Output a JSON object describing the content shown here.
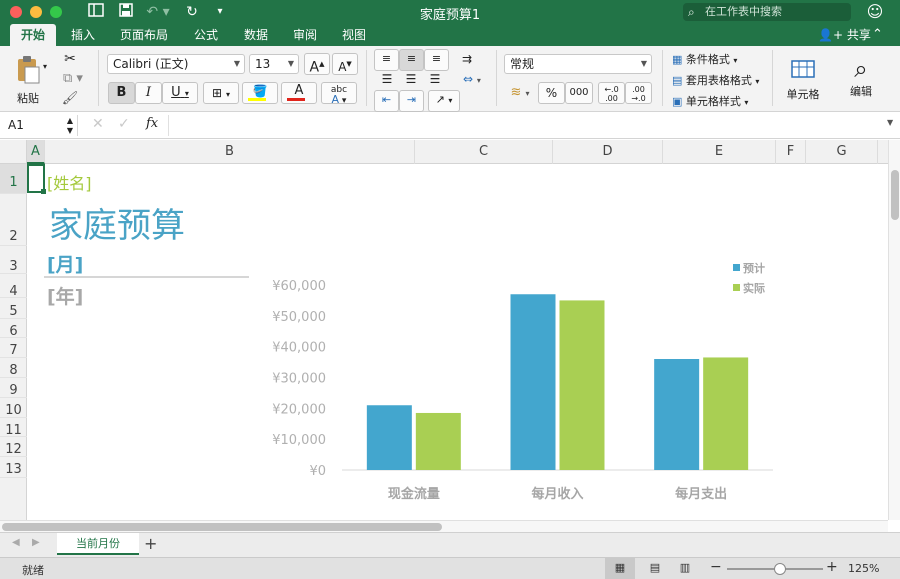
{
  "window": {
    "title": "家庭预算1",
    "search_placeholder": "在工作表中搜索",
    "traffic_colors": [
      "#fc605c",
      "#fdbc40",
      "#34c84a"
    ]
  },
  "tabs": [
    "开始",
    "插入",
    "页面布局",
    "公式",
    "数据",
    "审阅",
    "视图"
  ],
  "share_label": "共享",
  "ribbon": {
    "paste_label": "粘贴",
    "font_name": "Calibri (正文)",
    "font_size": "13",
    "grow_label": "A",
    "shrink_label": "A",
    "bold": "B",
    "italic": "I",
    "underline": "U",
    "font_color_label": "A",
    "highlight_color": "#ffff00",
    "font_color": "#e0241b",
    "number_format": "常规",
    "percent": "%",
    "comma": "000",
    "inc_decimal": "←.0 .00",
    "dec_decimal": ".00 →.0",
    "cond_format": "条件格式",
    "table_format": "套用表格格式",
    "cell_style": "单元格样式",
    "cells_label": "单元格",
    "edit_label": "编辑"
  },
  "formula_bar": {
    "name_box": "A1",
    "fx": "fx",
    "value": ""
  },
  "columns": [
    "A",
    "B",
    "C",
    "D",
    "E",
    "F",
    "G"
  ],
  "rows": [
    "1",
    "2",
    "3",
    "4",
    "5",
    "6",
    "7",
    "8",
    "9",
    "10",
    "11",
    "12",
    "13"
  ],
  "cells": {
    "name": "[姓名]",
    "title": "家庭预算",
    "month": "[月]",
    "year": "[年]"
  },
  "colors": {
    "accent": "#227447",
    "title_blue": "#4aa3c6",
    "name_green": "#a4c93c",
    "year_gray": "#a8a8a8",
    "series_budget": "#43a6ce",
    "series_actual": "#a9cf53"
  },
  "chart_data": {
    "type": "bar",
    "categories": [
      "现金流量",
      "每月收入",
      "每月支出"
    ],
    "series": [
      {
        "name": "预计",
        "values": [
          21000,
          57000,
          36000
        ],
        "color": "#43a6ce"
      },
      {
        "name": "实际",
        "values": [
          18500,
          55000,
          36500
        ],
        "color": "#a9cf53"
      }
    ],
    "yticks": [
      "¥0",
      "¥10,000",
      "¥20,000",
      "¥30,000",
      "¥40,000",
      "¥50,000",
      "¥60,000"
    ],
    "ylim": [
      0,
      60000
    ],
    "grid": false,
    "legend": "top-right"
  },
  "sheet_tabs": [
    "当前月份"
  ],
  "add_sheet": "+",
  "status": {
    "ready": "就绪",
    "zoom_minus": "−",
    "zoom_plus": "+",
    "zoom": "125%",
    "zoom_level": 0.55
  }
}
